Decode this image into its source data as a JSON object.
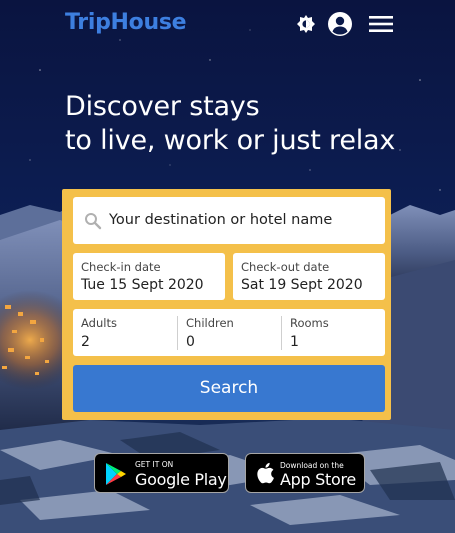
{
  "header": {
    "logo": "TripHouse",
    "icons": [
      "theme-toggle-icon",
      "account-icon",
      "hamburger-menu-icon"
    ]
  },
  "hero": {
    "line1": "Discover stays",
    "line2": "to live, work or just relax"
  },
  "search": {
    "destination_placeholder": "Your destination or hotel name",
    "checkin_label": "Check-in date",
    "checkin_value": "Tue 15 Sept 2020",
    "checkout_label": "Check-out date",
    "checkout_value": "Sat 19 Sept 2020",
    "adults_label": "Adults",
    "adults_value": "2",
    "children_label": "Children",
    "children_value": "0",
    "rooms_label": "Rooms",
    "rooms_value": "1",
    "button_label": "Search"
  },
  "stores": {
    "google_small": "GET IT ON",
    "google_big": "Google Play",
    "apple_small": "Download on the",
    "apple_big": "App Store"
  },
  "colors": {
    "logo": "#3d7fe0",
    "panel": "#f4c04a",
    "button": "#3878d0",
    "sky": "#0b1a4a"
  }
}
